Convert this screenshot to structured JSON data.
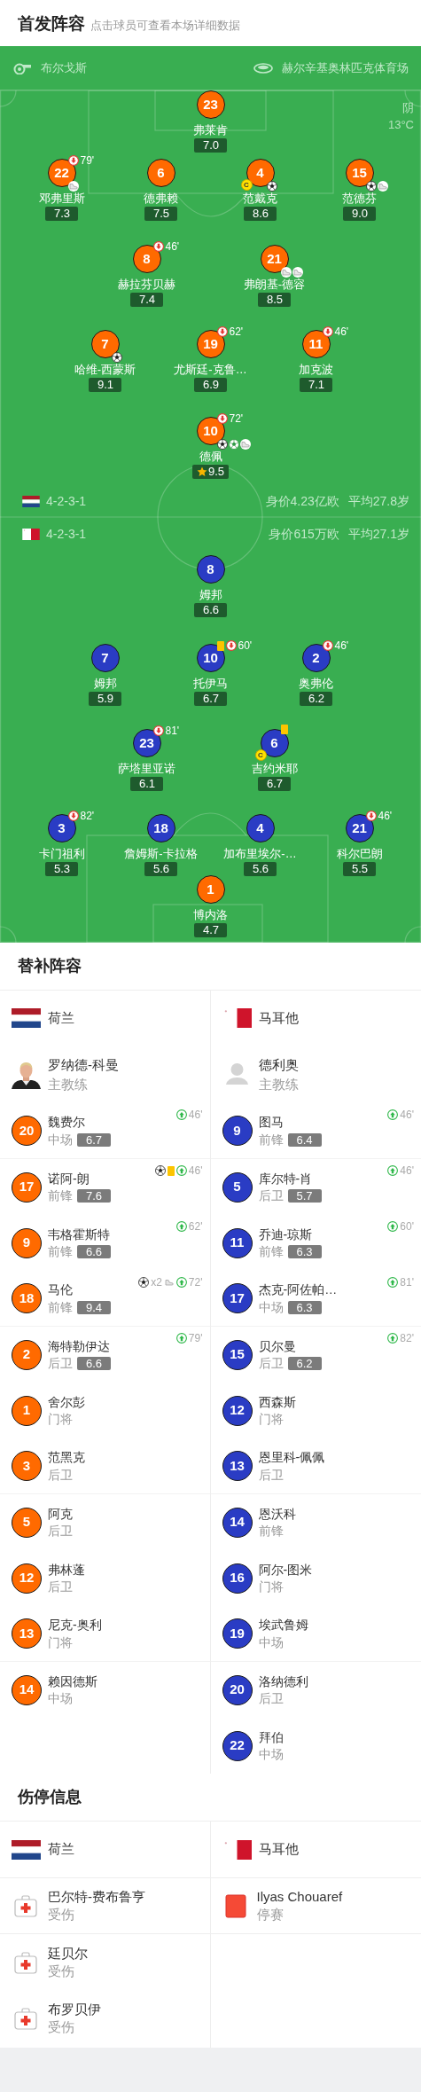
{
  "lineup_header": {
    "title": "首发阵容",
    "hint": "点击球员可查看本场详细数据"
  },
  "pitch": {
    "referee": "布尔戈斯",
    "stadium": "赫尔辛基奥林匹克体育场",
    "weather": "阴",
    "temperature": "13°C",
    "home": {
      "color": "#ff6a00",
      "rows": [
        [
          {
            "number": "23",
            "name": "弗莱肯",
            "rating": "7.0"
          }
        ],
        [
          {
            "number": "22",
            "name": "邓弗里斯",
            "rating": "7.3",
            "events": [
              {
                "kind": "sub_out",
                "minute": "79'"
              },
              {
                "kind": "assist"
              }
            ]
          },
          {
            "number": "6",
            "name": "德弗赖",
            "rating": "7.5"
          },
          {
            "number": "4",
            "name": "范戴克",
            "rating": "8.6",
            "captain": "C",
            "events": [
              {
                "kind": "goal"
              }
            ]
          },
          {
            "number": "15",
            "name": "范德芬",
            "rating": "9.0",
            "events": [
              {
                "kind": "goal"
              },
              {
                "kind": "assist"
              }
            ]
          }
        ],
        [
          {
            "number": "8",
            "name": "赫拉芬贝赫",
            "rating": "7.4",
            "events": [
              {
                "kind": "sub_out",
                "minute": "46'"
              }
            ]
          },
          {
            "number": "21",
            "name": "弗朗基-德容",
            "rating": "8.5",
            "events": [
              {
                "kind": "assist"
              },
              {
                "kind": "assist"
              }
            ]
          }
        ],
        [
          {
            "number": "7",
            "name": "哈维-西蒙斯",
            "rating": "9.1",
            "events": [
              {
                "kind": "goal"
              }
            ]
          },
          {
            "number": "19",
            "name": "尤斯廷-克鲁…",
            "rating": "6.9",
            "events": [
              {
                "kind": "sub_out",
                "minute": "62'"
              }
            ]
          },
          {
            "number": "11",
            "name": "加克波",
            "rating": "7.1",
            "events": [
              {
                "kind": "sub_out",
                "minute": "46'"
              }
            ]
          }
        ],
        [
          {
            "number": "10",
            "name": "德佩",
            "rating": "9.5",
            "mvp": true,
            "events": [
              {
                "kind": "sub_out",
                "minute": "72'"
              },
              {
                "kind": "goal"
              },
              {
                "kind": "penalty_goal"
              },
              {
                "kind": "assist"
              }
            ]
          }
        ]
      ]
    },
    "home_summary": {
      "formation": "4-2-3-1",
      "value": "身价4.23亿欧",
      "age": "平均27.8岁"
    },
    "away_summary": {
      "formation": "4-2-3-1",
      "value": "身价615万欧",
      "age": "平均27.1岁"
    },
    "away": {
      "color": "#2a3cc4",
      "rows": [
        [
          {
            "number": "8",
            "name": "姆邦",
            "rating": "6.6"
          }
        ],
        [
          {
            "number": "7",
            "name": "姆邦",
            "rating": "5.9"
          },
          {
            "number": "10",
            "name": "托伊马",
            "rating": "6.7",
            "events": [
              {
                "kind": "yellow"
              },
              {
                "kind": "sub_out",
                "minute": "60'"
              }
            ]
          },
          {
            "number": "2",
            "name": "奥弗伦",
            "rating": "6.2",
            "events": [
              {
                "kind": "sub_out",
                "minute": "46'"
              }
            ]
          }
        ],
        [
          {
            "number": "23",
            "name": "萨塔里亚诺",
            "rating": "6.1",
            "events": [
              {
                "kind": "sub_out",
                "minute": "81'"
              }
            ]
          },
          {
            "number": "6",
            "name": "吉约米耶",
            "rating": "6.7",
            "captain": "C",
            "events": [
              {
                "kind": "yellow"
              }
            ]
          }
        ],
        [
          {
            "number": "3",
            "name": "卡门祖利",
            "rating": "5.3",
            "events": [
              {
                "kind": "sub_out",
                "minute": "82'"
              }
            ]
          },
          {
            "number": "18",
            "name": "詹姆斯-卡拉格",
            "rating": "5.6"
          },
          {
            "number": "4",
            "name": "加布里埃尔-…",
            "rating": "5.6"
          },
          {
            "number": "21",
            "name": "科尔巴朗",
            "rating": "5.5",
            "events": [
              {
                "kind": "sub_out",
                "minute": "46'"
              }
            ]
          }
        ],
        [
          {
            "number": "1",
            "name": "博内洛",
            "rating": "4.7",
            "color": "#ff6a00"
          }
        ]
      ]
    }
  },
  "subs": {
    "title": "替补阵容",
    "teams": [
      {
        "name": "荷兰",
        "color": "#ff6a00",
        "coach": {
          "name": "罗纳德-科曼",
          "role": "主教练",
          "kind": "picture"
        },
        "players": [
          {
            "number": "20",
            "name": "魏费尔",
            "position": "中场",
            "rating": "6.7",
            "events": [
              {
                "kind": "sub_in",
                "minute": "46'"
              }
            ]
          },
          {
            "number": "17",
            "name": "诺阿-朗",
            "position": "前锋",
            "rating": "7.6",
            "events": [
              {
                "kind": "goal"
              },
              {
                "kind": "yellow"
              },
              {
                "kind": "sub_in",
                "minute": "46'"
              }
            ]
          },
          {
            "number": "9",
            "name": "韦格霍斯特",
            "position": "前锋",
            "rating": "6.6",
            "events": [
              {
                "kind": "sub_in",
                "minute": "62'"
              }
            ]
          },
          {
            "number": "18",
            "name": "马伦",
            "position": "前锋",
            "rating": "9.4",
            "events": [
              {
                "kind": "goal",
                "count": "x2"
              },
              {
                "kind": "assist"
              },
              {
                "kind": "sub_in",
                "minute": "72'"
              }
            ]
          },
          {
            "number": "2",
            "name": "海特勒伊达",
            "position": "后卫",
            "rating": "6.6",
            "events": [
              {
                "kind": "sub_in",
                "minute": "79'"
              }
            ]
          },
          {
            "number": "1",
            "name": "舍尔彭",
            "position": "门将"
          },
          {
            "number": "3",
            "name": "范黑克",
            "position": "后卫"
          },
          {
            "number": "5",
            "name": "阿克",
            "position": "后卫"
          },
          {
            "number": "12",
            "name": "弗林蓬",
            "position": "后卫"
          },
          {
            "number": "13",
            "name": "尼克-奥利",
            "position": "门将"
          },
          {
            "number": "14",
            "name": "赖因德斯",
            "position": "中场"
          }
        ]
      },
      {
        "name": "马耳他",
        "color": "#2a3cc4",
        "coach": {
          "name": "德利奥",
          "role": "主教练"
        },
        "players": [
          {
            "number": "9",
            "name": "图马",
            "position": "前锋",
            "rating": "6.4",
            "events": [
              {
                "kind": "sub_in",
                "minute": "46'"
              }
            ]
          },
          {
            "number": "5",
            "name": "库尔特-肖",
            "position": "后卫",
            "rating": "5.7",
            "events": [
              {
                "kind": "sub_in",
                "minute": "46'"
              }
            ]
          },
          {
            "number": "11",
            "name": "乔迪-琼斯",
            "position": "前锋",
            "rating": "6.3",
            "events": [
              {
                "kind": "sub_in",
                "minute": "60'"
              }
            ]
          },
          {
            "number": "17",
            "name": "杰克-阿佐帕…",
            "position": "中场",
            "rating": "6.3",
            "events": [
              {
                "kind": "sub_in",
                "minute": "81'"
              }
            ]
          },
          {
            "number": "15",
            "name": "贝尔曼",
            "position": "后卫",
            "rating": "6.2",
            "events": [
              {
                "kind": "sub_in",
                "minute": "82'"
              }
            ]
          },
          {
            "number": "12",
            "name": "西森斯",
            "position": "门将"
          },
          {
            "number": "13",
            "name": "恩里科-佩佩",
            "position": "后卫"
          },
          {
            "number": "14",
            "name": "恩沃科",
            "position": "前锋"
          },
          {
            "number": "16",
            "name": "阿尔-图米",
            "position": "门将"
          },
          {
            "number": "19",
            "name": "埃武鲁姆",
            "position": "中场"
          },
          {
            "number": "20",
            "name": "洛纳德利",
            "position": "后卫"
          },
          {
            "number": "22",
            "name": "拜伯",
            "position": "中场"
          }
        ]
      }
    ]
  },
  "injuries": {
    "title": "伤停信息",
    "teams": [
      {
        "name": "荷兰",
        "players": [
          {
            "name": "巴尔特-费布鲁亨",
            "status": "受伤",
            "kind": "injury"
          },
          {
            "name": "廷贝尔",
            "status": "受伤",
            "kind": "injury"
          },
          {
            "name": "布罗贝伊",
            "status": "受伤",
            "kind": "injury"
          }
        ]
      },
      {
        "name": "马耳他",
        "players": [
          {
            "name": "Ilyas Chouaref",
            "status": "停赛",
            "kind": "suspension"
          }
        ]
      }
    ]
  }
}
